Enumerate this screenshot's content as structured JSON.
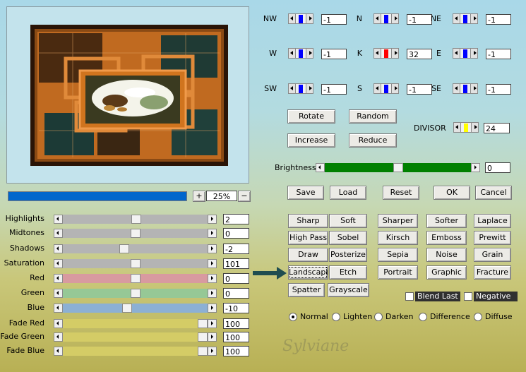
{
  "compass": {
    "cells": [
      {
        "label": "NW",
        "value": "-1",
        "marker": "#0000ff"
      },
      {
        "label": "N",
        "value": "-1",
        "marker": "#0000ff"
      },
      {
        "label": "NE",
        "value": "-1",
        "marker": "#0000ff"
      },
      {
        "label": "W",
        "value": "-1",
        "marker": "#0000ff"
      },
      {
        "label": "K",
        "value": "32",
        "marker": "#ff0000"
      },
      {
        "label": "E",
        "value": "-1",
        "marker": "#0000ff"
      },
      {
        "label": "SW",
        "value": "-1",
        "marker": "#0000ff"
      },
      {
        "label": "S",
        "value": "-1",
        "marker": "#0000ff"
      },
      {
        "label": "SE",
        "value": "-1",
        "marker": "#0000ff"
      }
    ]
  },
  "matrix_buttons": {
    "rotate": "Rotate",
    "random": "Random",
    "increase": "Increase",
    "reduce": "Reduce"
  },
  "divisor": {
    "label": "DIVISOR",
    "value": "24",
    "marker": "#ffff00"
  },
  "brightness": {
    "label": "Brightness",
    "value": "0",
    "fraction": 0.5
  },
  "actions": {
    "save": "Save",
    "load": "Load",
    "reset": "Reset",
    "ok": "OK",
    "cancel": "Cancel"
  },
  "zoom": {
    "plus": "+",
    "minus": "−",
    "value": "25%",
    "progress": 1.0
  },
  "adjustments": [
    {
      "label": "Highlights",
      "value": "2",
      "color": "#b4b4b4",
      "fraction": 0.51
    },
    {
      "label": "Midtones",
      "value": "0",
      "color": "#b4b4b4",
      "fraction": 0.5
    },
    {
      "label": "Shadows",
      "value": "-2",
      "color": "#b4b4b4",
      "fraction": 0.42
    },
    {
      "label": "Saturation",
      "value": "101",
      "color": "#b4b4b4",
      "fraction": 0.5
    },
    {
      "label": "Red",
      "value": "0",
      "color": "#d89aa0",
      "fraction": 0.5
    },
    {
      "label": "Green",
      "value": "0",
      "color": "#96c896",
      "fraction": 0.5
    },
    {
      "label": "Blue",
      "value": "-10",
      "color": "#8cb0d4",
      "fraction": 0.44
    },
    {
      "label": "Fade Red",
      "value": "100",
      "color": "#d4cc66",
      "fraction": 1.0
    },
    {
      "label": "Fade Green",
      "value": "100",
      "color": "#d4cc66",
      "fraction": 1.0
    },
    {
      "label": "Fade Blue",
      "value": "100",
      "color": "#d4cc66",
      "fraction": 1.0
    }
  ],
  "presets": [
    [
      "Sharp",
      "Soft",
      "Sharper",
      "Softer",
      "Laplace"
    ],
    [
      "High Pass",
      "Sobel",
      "Kirsch",
      "Emboss",
      "Prewitt"
    ],
    [
      "Draw",
      "Posterize",
      "Sepia",
      "Noise",
      "Grain"
    ],
    [
      "Landscape",
      "Etch",
      "Portrait",
      "Graphic",
      "Fracture"
    ],
    [
      "Spatter",
      "Grayscale"
    ]
  ],
  "options": {
    "blend_last": "Blend Last",
    "negative": "Negative"
  },
  "modes": [
    {
      "label": "Normal",
      "selected": true
    },
    {
      "label": "Lighten",
      "selected": false
    },
    {
      "label": "Darken",
      "selected": false
    },
    {
      "label": "Difference",
      "selected": false
    },
    {
      "label": "Diffuse",
      "selected": false
    }
  ],
  "watermark": "Sylviane",
  "colors": {
    "accent": "#0066cc",
    "highlight_arrow": "#1f4d50"
  }
}
